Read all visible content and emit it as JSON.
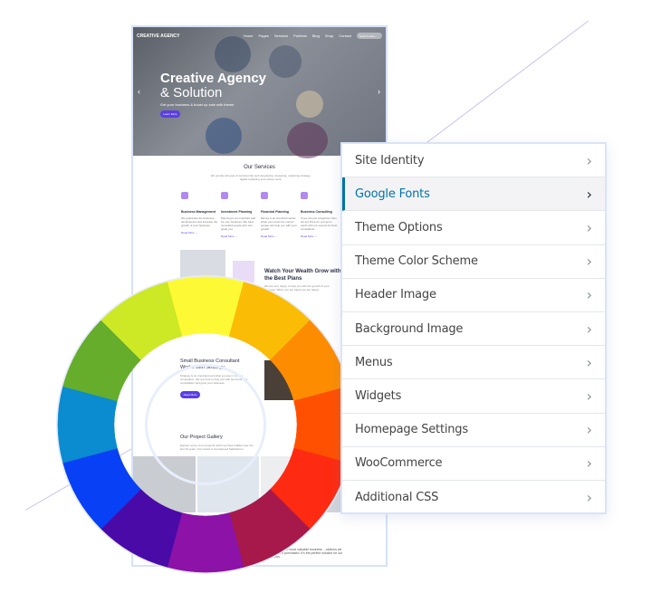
{
  "site": {
    "logo": "CREATIVE AGENCY",
    "nav": [
      "Home",
      "Pages",
      "Services",
      "Portfolio",
      "Blog",
      "Shop",
      "Contact"
    ],
    "search_placeholder": "Search Here...",
    "hero": {
      "title": "Creative Agency",
      "title2": "& Solution",
      "subtitle": "Get your business & boost up sale with theme",
      "button": "Learn More"
    },
    "services": {
      "title": "Our Services",
      "intro": "We provide all types of services like web developing, designing, marketing strategy, digital marketing and custom work.",
      "items": [
        {
          "title": "Business Management",
          "text": "We guarantee the business development and increase the growth of your business.",
          "link": "Read More →"
        },
        {
          "title": "Investment Planning",
          "text": "Planning is an important part for your business. We have consulted people who can guide you.",
          "link": "Read More →"
        },
        {
          "title": "Financial Planning",
          "text": "Money is an important sector when you invest the correct people can help you with your growth.",
          "link": "Read More →"
        },
        {
          "title": "Business Consulting",
          "text": "If you are just a beginner then we are there for you get in touch with our experts for best consultants.",
          "link": "Read More →"
        }
      ]
    },
    "wealth": {
      "title": "Watch Your Wealth Grow with the Best Plans",
      "text": "We are very happy to help you with the growth of your business. When you are happy we are happy."
    },
    "consult": {
      "title": "Small Business Consultant Works with Strategy",
      "text": "Strategy is an important part what you are in market competition. We are here to help you with best business consultation and grow your business.",
      "button": "Read More"
    },
    "gallery": {
      "title": "Our Project Gallery",
      "text": "Explore some of our projects which we have fulfilled over the last 10 years. Our results is Guaranteed Satisfaction."
    },
    "footer_text": "...agency is the most valuable business ...olutions we have EVER purchased. It's the perfect solution for our business."
  },
  "customizer": {
    "items": [
      {
        "label": "Site Identity"
      },
      {
        "label": "Google Fonts",
        "active": true
      },
      {
        "label": "Theme Options"
      },
      {
        "label": "Theme Color Scheme"
      },
      {
        "label": "Header Image"
      },
      {
        "label": "Background Image"
      },
      {
        "label": "Menus"
      },
      {
        "label": "Widgets"
      },
      {
        "label": "Homepage Settings"
      },
      {
        "label": "WooCommerce"
      },
      {
        "label": "Additional CSS"
      }
    ],
    "chevron_icon": "chevron-right-icon",
    "accent": "#0073aa"
  },
  "colors": {
    "wheel": [
      "#fdfa35",
      "#fbbc05",
      "#fd8c00",
      "#fe5000",
      "#fe2a11",
      "#a7194b",
      "#8c12a8",
      "#4a0aa8",
      "#0740f5",
      "#0b8bd0",
      "#65ad2b",
      "#cde824"
    ],
    "brand": "#5b3ee6"
  }
}
